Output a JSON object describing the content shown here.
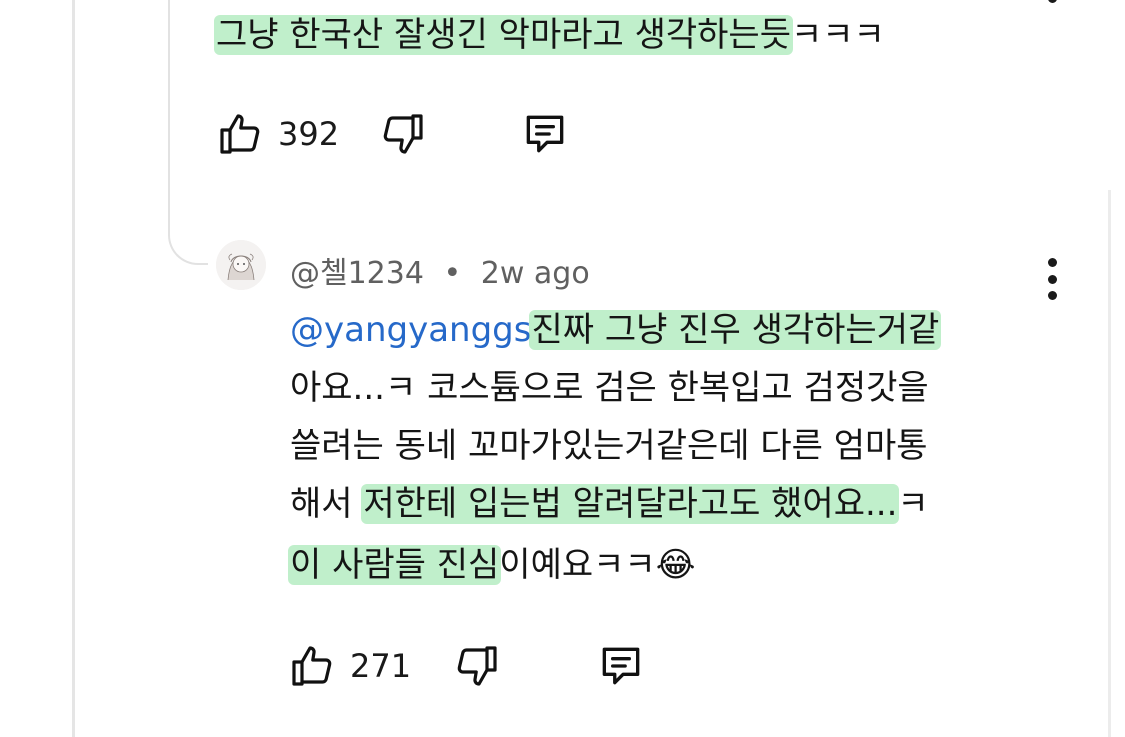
{
  "top_comment": {
    "text_highlighted": "그냥 한국산 잘생긴 악마라고 생각하는듯",
    "text_plain": "ㅋㅋㅋ",
    "like_count": "392"
  },
  "reply": {
    "author": "@첼1234",
    "separator": "•",
    "time_ago": "2w ago",
    "mention": "@yangyanggs",
    "line1_highlighted": "진짜 그냥 진우 생각하는거같",
    "line2": "아요...ㅋ 코스튬으로 검은 한복입고 검정갓을",
    "line3": "쓸려는 동네 꼬마가있는거같은데 다른 엄마통",
    "line4_prefix": "해서 ",
    "line4_highlighted": "저한테 입는법 알려달라고도 했어요...",
    "line4_suffix": "ㅋ",
    "line5_highlighted": "이 사람들 진심",
    "line5_plain": "이예요ㅋㅋ",
    "emoji": "😂",
    "like_count": "271"
  },
  "icons": {
    "like": "thumbs-up-icon",
    "dislike": "thumbs-down-icon",
    "reply": "comment-icon",
    "more": "more-vertical-icon"
  },
  "colors": {
    "highlight": "#8ce1a0",
    "mention": "#2669c9",
    "meta_text": "#606060"
  }
}
